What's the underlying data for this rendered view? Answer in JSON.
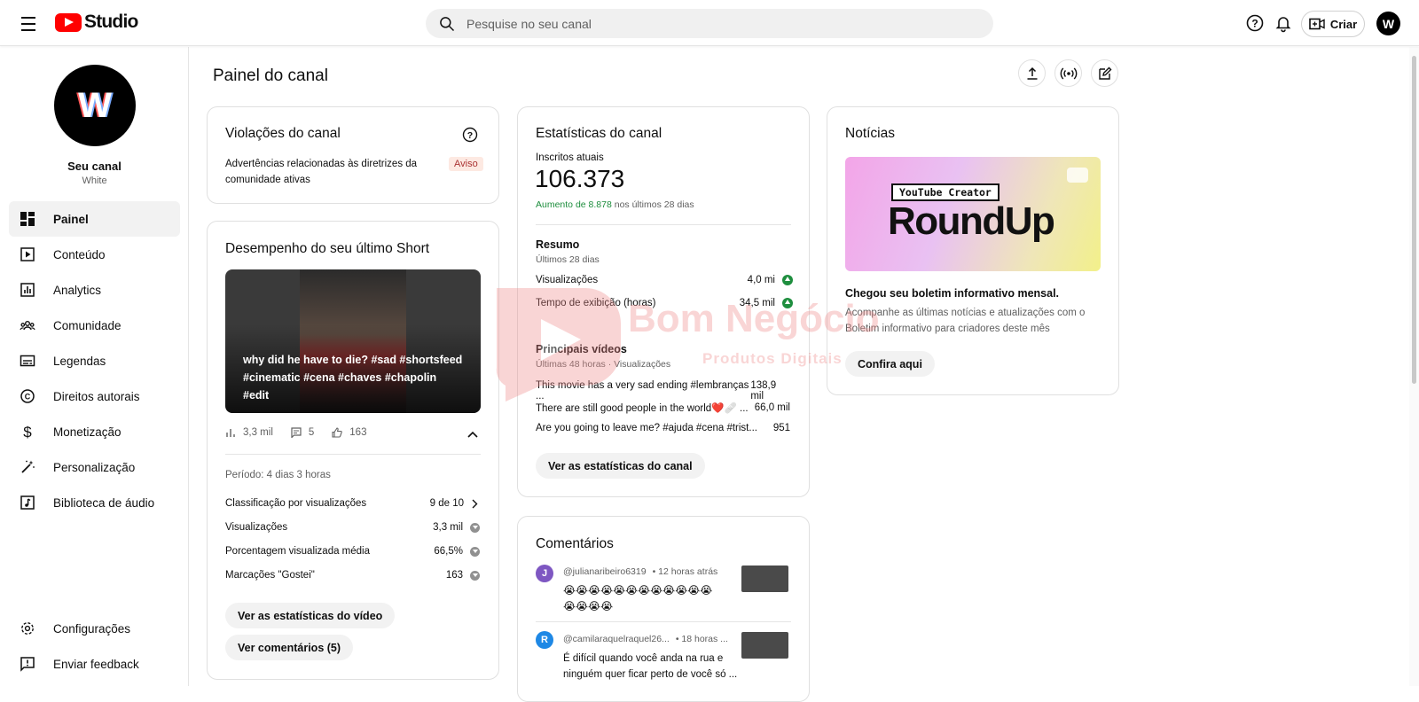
{
  "topbar": {
    "studio_label": "Studio",
    "search_placeholder": "Pesquise no seu canal",
    "create_label": "Criar",
    "avatar_letter": "W"
  },
  "sidebar": {
    "channel_letter": "W",
    "channel_name": "Seu canal",
    "channel_sub": "White",
    "items": [
      {
        "label": "Painel",
        "icon": "dashboard-icon"
      },
      {
        "label": "Conteúdo",
        "icon": "content-icon"
      },
      {
        "label": "Analytics",
        "icon": "analytics-icon"
      },
      {
        "label": "Comunidade",
        "icon": "community-icon"
      },
      {
        "label": "Legendas",
        "icon": "subtitles-icon"
      },
      {
        "label": "Direitos autorais",
        "icon": "copyright-icon"
      },
      {
        "label": "Monetização",
        "icon": "monetization-icon"
      },
      {
        "label": "Personalização",
        "icon": "customization-icon"
      },
      {
        "label": "Biblioteca de áudio",
        "icon": "audio-library-icon"
      }
    ],
    "settings_label": "Configurações",
    "feedback_label": "Enviar feedback"
  },
  "main": {
    "title": "Painel do canal"
  },
  "violations": {
    "title": "Violações do canal",
    "text": "Advertências relacionadas às diretrizes da comunidade ativas",
    "badge": "Aviso"
  },
  "short": {
    "title": "Desempenho do seu último Short",
    "caption": "why did he have to die? #sad #shortsfeed #cinematic #cena #chaves #chapolin #edit",
    "views": "3,3 mil",
    "comments": "5",
    "likes": "163",
    "period": "Período: 4 dias 3 horas",
    "rows": [
      {
        "label": "Classificação por visualizações",
        "value": "9 de 10"
      },
      {
        "label": "Visualizações",
        "value": "3,3 mil"
      },
      {
        "label": "Porcentagem visualizada média",
        "value": "66,5%"
      },
      {
        "label": "Marcações \"Gostei\"",
        "value": "163"
      }
    ],
    "btn_stats": "Ver as estatísticas do vídeo",
    "btn_comments": "Ver comentários (5)"
  },
  "stats": {
    "title": "Estatísticas do canal",
    "subs_label": "Inscritos atuais",
    "subs_value": "106.373",
    "growth_green": "Aumento de 8.878",
    "growth_rest": " nos últimos 28 dias",
    "summary_title": "Resumo",
    "summary_sub": "Últimos 28 dias",
    "summary_rows": [
      {
        "label": "Visualizações",
        "value": "4,0 mi"
      },
      {
        "label": "Tempo de exibição (horas)",
        "value": "34,5 mil"
      }
    ],
    "top_title": "Principais vídeos",
    "top_sub": "Últimas 48 horas · Visualizações",
    "top_rows": [
      {
        "label": "This movie has a very sad ending #lembranças ...",
        "value": "138,9 mil"
      },
      {
        "label": "There are still good people in the world❤️🩹 ...",
        "value": "66,0 mil"
      },
      {
        "label": "Are you going to leave me? #ajuda #cena #trist...",
        "value": "951"
      }
    ],
    "btn": "Ver as estatísticas do canal"
  },
  "comments": {
    "title": "Comentários",
    "items": [
      {
        "letter": "J",
        "color": "#7e57c2",
        "user": "@julianaribeiro6319",
        "time": "• 12 horas atrás",
        "text_line1": "😭😭😭😭😭😭😭😭😭😭😭😭",
        "text_line2": "😭😭😭😭"
      },
      {
        "letter": "R",
        "color": "#1e88e5",
        "user": "@camilaraquelraquel26...",
        "time": "• 18 horas ...",
        "text_line1": "É difícil quando você anda na  rua e",
        "text_line2": "ninguém quer ficar perto de você só ..."
      }
    ]
  },
  "news": {
    "title": "Notícias",
    "img_tag": "YouTube Creator",
    "img_big": "RoundUp",
    "headline": "Chegou seu boletim informativo mensal.",
    "body": "Acompanhe as últimas notícias e atualizações com o Boletim informativo para criadores deste mês",
    "btn": "Confira aqui"
  },
  "watermark": {
    "line1": "Bom Negócio",
    "line2": "Produtos Digitais"
  }
}
